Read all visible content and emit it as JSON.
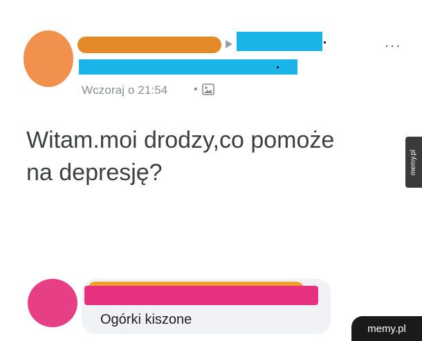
{
  "post": {
    "timestamp": "Wczoraj o 21:54",
    "separator": "•",
    "more_menu": "...",
    "body_line1": "Witam.moi drodzy,co pomoże",
    "body_line2": "na depresję?"
  },
  "comment": {
    "text": "Ogórki kiszone"
  },
  "watermarks": {
    "side": "memy.pl",
    "corner": "memy.pl"
  },
  "colors": {
    "op_avatar": "#f2914e",
    "op_name_scribble": "#e58a28",
    "group_scribble": "#1ab4e8",
    "comment_avatar": "#e63f86",
    "comment_name_scribble": "#e6317f",
    "comment_bubble": "#f0f2f5"
  },
  "icons": {
    "share_arrow": "arrow-right-icon",
    "privacy": "photo-icon",
    "more": "more-horizontal-icon"
  }
}
